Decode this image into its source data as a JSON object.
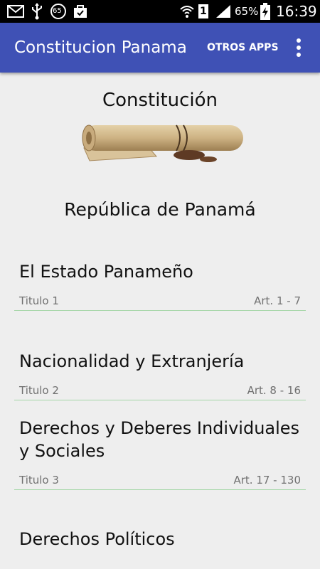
{
  "status_bar": {
    "battery": "65%",
    "time": "16:39",
    "sim_badge": "1",
    "notification_badge": "65",
    "icons": [
      "mail-icon",
      "usb-icon",
      "notification-65-icon",
      "shopping-bag-icon",
      "wifi-icon",
      "sim-1-icon",
      "signal-icon",
      "battery-charging-icon"
    ]
  },
  "app_bar": {
    "title": "Constitucion Panama",
    "otros_apps": "OTROS APPS",
    "menu_icon": "overflow-menu-icon",
    "color": "#3f51b5"
  },
  "header": {
    "title": "Constitución",
    "image": "scroll-image",
    "subtitle": "República de Panamá"
  },
  "items": [
    {
      "title": "El Estado Panameño",
      "titulo": "Titulo 1",
      "articles": "Art. 1 - 7"
    },
    {
      "title": "Nacionalidad y Extranjería",
      "titulo": "Titulo 2",
      "articles": "Art. 8 - 16"
    },
    {
      "title": "Derechos y Deberes Individuales y Sociales",
      "titulo": "Titulo 3",
      "articles": "Art. 17 - 130"
    },
    {
      "title": "Derechos Políticos",
      "titulo": "",
      "articles": ""
    }
  ]
}
